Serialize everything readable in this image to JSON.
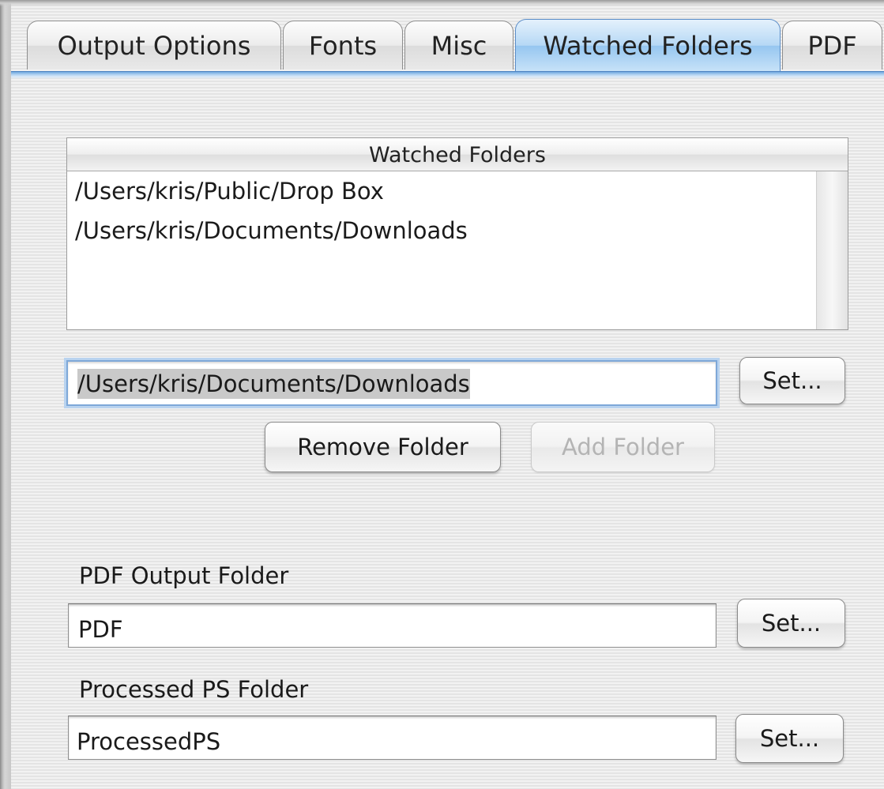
{
  "tabs": [
    {
      "label": "Output Options",
      "selected": false
    },
    {
      "label": "Fonts",
      "selected": false
    },
    {
      "label": "Misc",
      "selected": false
    },
    {
      "label": "Watched Folders",
      "selected": true
    },
    {
      "label": "PDF",
      "selected": false
    }
  ],
  "watched_folders": {
    "header": "Watched Folders",
    "rows": [
      "/Users/kris/Public/Drop Box",
      "/Users/kris/Documents/Downloads"
    ]
  },
  "folder_path": {
    "value": "/Users/kris/Documents/Downloads",
    "set_label": "Set..."
  },
  "actions": {
    "remove_label": "Remove Folder",
    "add_label": "Add Folder"
  },
  "pdf_output": {
    "label": "PDF Output Folder",
    "value": "PDF",
    "set_label": "Set..."
  },
  "processed_ps": {
    "label": "Processed PS Folder",
    "value": "ProcessedPS",
    "set_label": "Set..."
  }
}
